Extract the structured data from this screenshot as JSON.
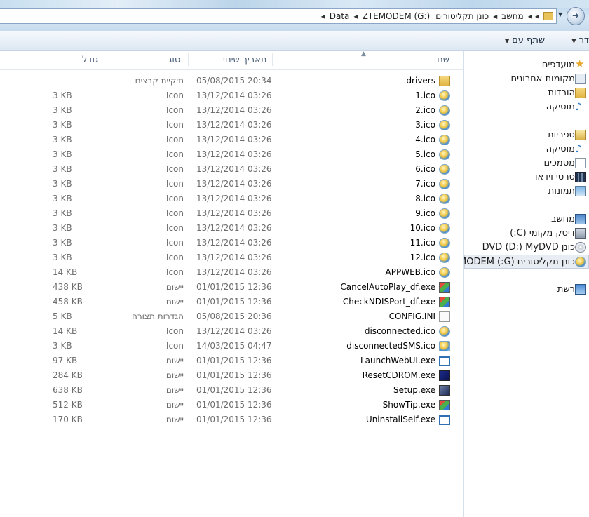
{
  "address": {
    "crumbs": [
      "Data",
      "ZTEMODEM (G:)",
      "כונן תקליטורים",
      "מחשב"
    ]
  },
  "toolbar": {
    "organize_label": "דר",
    "share_label": "שתף עם"
  },
  "columns": {
    "name": "שם",
    "date": "תאריך שינוי",
    "type": "סוג",
    "size": "גודל"
  },
  "files": [
    {
      "name": "drivers",
      "date": "05/08/2015 20:34",
      "type": "תיקיית קבצים",
      "size": "",
      "icon": "folder-icon"
    },
    {
      "name": "1.ico",
      "date": "13/12/2014 03:26",
      "type": "Icon",
      "size": "3 KB",
      "icon": "ico-file-icon"
    },
    {
      "name": "2.ico",
      "date": "13/12/2014 03:26",
      "type": "Icon",
      "size": "3 KB",
      "icon": "ico-file-icon"
    },
    {
      "name": "3.ico",
      "date": "13/12/2014 03:26",
      "type": "Icon",
      "size": "3 KB",
      "icon": "ico-file-icon"
    },
    {
      "name": "4.ico",
      "date": "13/12/2014 03:26",
      "type": "Icon",
      "size": "3 KB",
      "icon": "ico-file-icon"
    },
    {
      "name": "5.ico",
      "date": "13/12/2014 03:26",
      "type": "Icon",
      "size": "3 KB",
      "icon": "ico-file-icon"
    },
    {
      "name": "6.ico",
      "date": "13/12/2014 03:26",
      "type": "Icon",
      "size": "3 KB",
      "icon": "ico-file-icon"
    },
    {
      "name": "7.ico",
      "date": "13/12/2014 03:26",
      "type": "Icon",
      "size": "3 KB",
      "icon": "ico-file-icon"
    },
    {
      "name": "8.ico",
      "date": "13/12/2014 03:26",
      "type": "Icon",
      "size": "3 KB",
      "icon": "ico-file-icon"
    },
    {
      "name": "9.ico",
      "date": "13/12/2014 03:26",
      "type": "Icon",
      "size": "3 KB",
      "icon": "ico-file-icon"
    },
    {
      "name": "10.ico",
      "date": "13/12/2014 03:26",
      "type": "Icon",
      "size": "3 KB",
      "icon": "ico-file-icon"
    },
    {
      "name": "11.ico",
      "date": "13/12/2014 03:26",
      "type": "Icon",
      "size": "3 KB",
      "icon": "ico-file-icon"
    },
    {
      "name": "12.ico",
      "date": "13/12/2014 03:26",
      "type": "Icon",
      "size": "3 KB",
      "icon": "ico-file-icon"
    },
    {
      "name": "APPWEB.ico",
      "date": "13/12/2014 03:26",
      "type": "Icon",
      "size": "14 KB",
      "icon": "ico-file-icon"
    },
    {
      "name": "CancelAutoPlay_df.exe",
      "date": "01/01/2015 12:36",
      "type": "יישום",
      "size": "438 KB",
      "icon": "app-color-icon"
    },
    {
      "name": "CheckNDISPort_df.exe",
      "date": "01/01/2015 12:36",
      "type": "יישום",
      "size": "458 KB",
      "icon": "app-color-icon"
    },
    {
      "name": "CONFIG.INI",
      "date": "05/08/2015 20:36",
      "type": "הגדרות תצורה",
      "size": "5 KB",
      "icon": "ini-file-icon"
    },
    {
      "name": "disconnected.ico",
      "date": "13/12/2014 03:26",
      "type": "Icon",
      "size": "14 KB",
      "icon": "ico-file-icon"
    },
    {
      "name": "disconnectedSMS.ico",
      "date": "14/03/2015 04:47",
      "type": "Icon",
      "size": "3 KB",
      "icon": "ico-mail-icon"
    },
    {
      "name": "LaunchWebUI.exe",
      "date": "01/01/2015 12:36",
      "type": "יישום",
      "size": "97 KB",
      "icon": "app-window-icon"
    },
    {
      "name": "ResetCDROM.exe",
      "date": "01/01/2015 12:36",
      "type": "יישום",
      "size": "284 KB",
      "icon": "app-dark-icon"
    },
    {
      "name": "Setup.exe",
      "date": "01/01/2015 12:36",
      "type": "יישום",
      "size": "638 KB",
      "icon": "setup-icon"
    },
    {
      "name": "ShowTip.exe",
      "date": "01/01/2015 12:36",
      "type": "יישום",
      "size": "512 KB",
      "icon": "app-color-icon"
    },
    {
      "name": "UninstallSelf.exe",
      "date": "01/01/2015 12:36",
      "type": "יישום",
      "size": "170 KB",
      "icon": "app-window-icon"
    }
  ],
  "nav": {
    "favorites": "מועדפים",
    "recent": "מקומות אחרונים",
    "downloads": "הורדות",
    "music_fav": "מוסיקה",
    "libraries": "ספריות",
    "music_lib": "מוסיקה",
    "documents": "מסמכים",
    "videos": "סרטי וידאו",
    "pictures": "תמונות",
    "computer": "מחשב",
    "local_disk": "דיסק מקומי (C:)",
    "dvd_drive": "כונן DVD (D:) MyDVD",
    "cd_drive": "כונן תקליטורים (G:) ZTEMODEM",
    "network": "רשת"
  }
}
